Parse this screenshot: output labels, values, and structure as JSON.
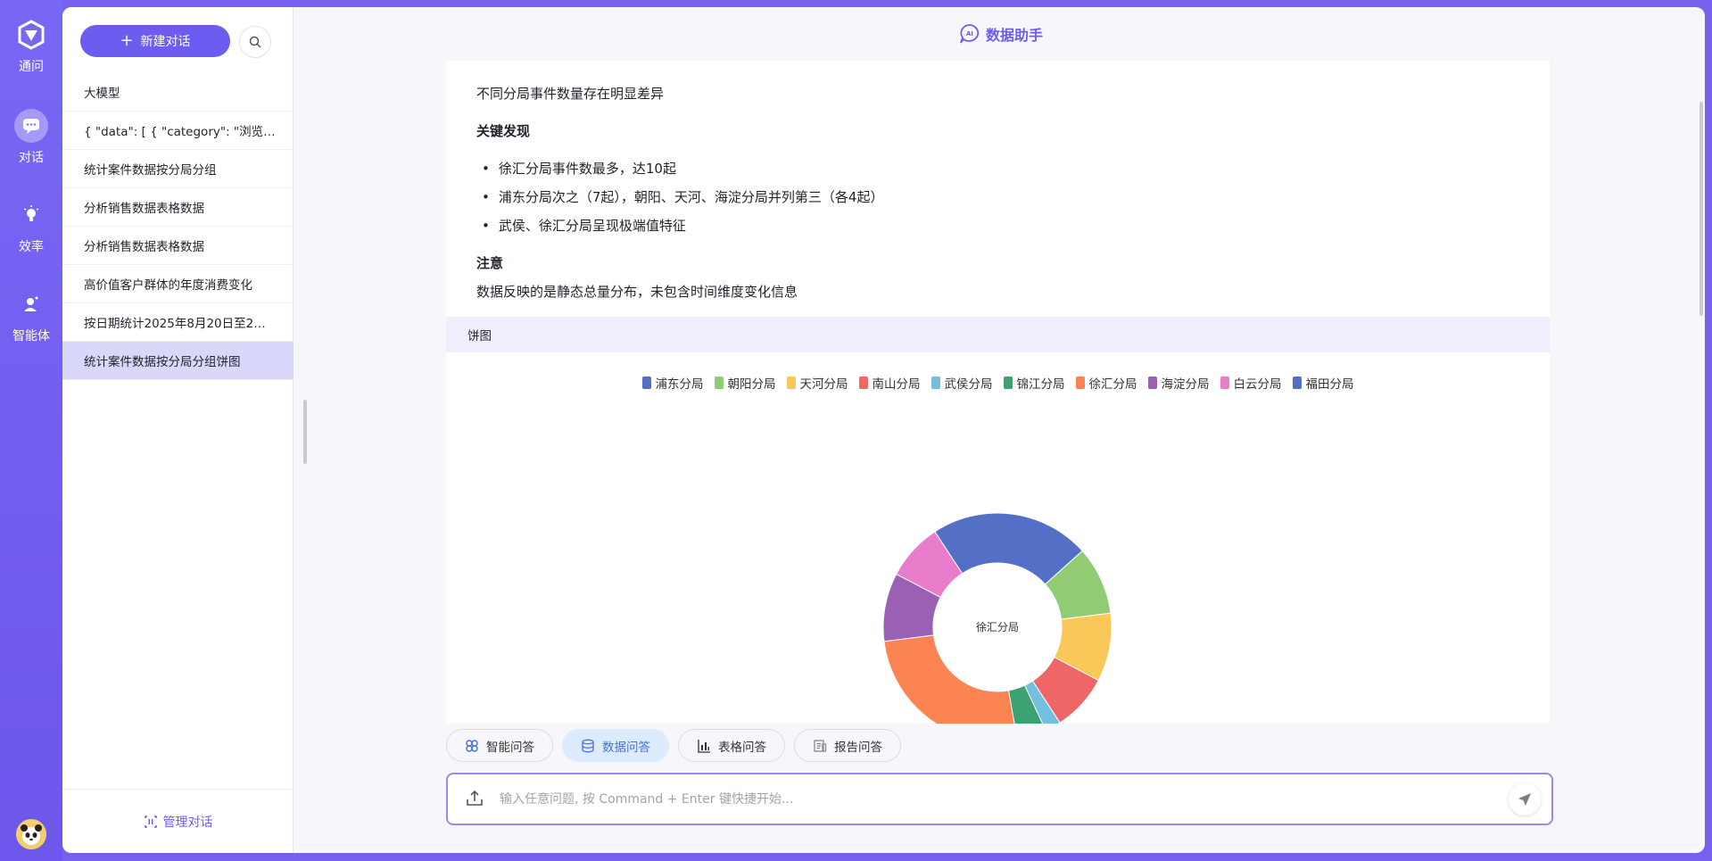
{
  "rail": {
    "logo_label": "通问",
    "items": [
      {
        "label": "对话",
        "icon": "chat-icon"
      },
      {
        "label": "效率",
        "icon": "lightbulb-icon"
      },
      {
        "label": "智能体",
        "icon": "agent-icon"
      }
    ]
  },
  "sidebar": {
    "new_chat_label": "新建对话",
    "conversations": [
      "大模型",
      "{ \"data\": [ { \"category\": \"浏览…",
      "统计案件数据按分局分组",
      "分析销售数据表格数据",
      "分析销售数据表格数据",
      "高价值客户群体的年度消费变化",
      "按日期统计2025年8月20日至2…",
      "统计案件数据按分局分组饼图"
    ],
    "active_index": 7,
    "manage_label": "管理对话"
  },
  "header": {
    "title": "数据助手",
    "badge": "AI"
  },
  "message": {
    "summary": "不同分局事件数量存在明显差异",
    "findings_title": "关键发现",
    "findings": [
      "徐汇分局事件数最多，达10起",
      "浦东分局次之（7起），朝阳、天河、海淀分局并列第三（各4起）",
      "武侯、徐汇分局呈现极端值特征"
    ],
    "note_title": "注意",
    "note": "数据反映的是静态总量分布，未包含时间维度变化信息",
    "chart_header": "饼图"
  },
  "chart_data": {
    "type": "pie",
    "donut": true,
    "center_label": "徐汇分局",
    "categories": [
      "浦东分局",
      "朝阳分局",
      "天河分局",
      "南山分局",
      "武侯分局",
      "锦江分局",
      "徐汇分局",
      "海淀分局",
      "白云分局",
      "福田分局"
    ],
    "values": [
      7,
      3,
      3,
      2.5,
      0.7,
      1.3,
      8,
      3,
      2.5,
      0
    ],
    "colors": [
      "#5470c6",
      "#91cc75",
      "#fac858",
      "#ee6666",
      "#73c0de",
      "#3ba272",
      "#fc8452",
      "#9a60b4",
      "#ea7ccc",
      "#5470c6"
    ],
    "legend_position": "top-center"
  },
  "modes": [
    {
      "label": "智能问答",
      "icon": "smart-qa-icon",
      "active": false
    },
    {
      "label": "数据问答",
      "icon": "database-icon",
      "active": true
    },
    {
      "label": "表格问答",
      "icon": "bar-chart-icon",
      "active": false
    },
    {
      "label": "报告问答",
      "icon": "report-icon",
      "active": false
    }
  ],
  "input": {
    "placeholder": "输入任意问题, 按 Command + Enter 键快捷开始..."
  }
}
